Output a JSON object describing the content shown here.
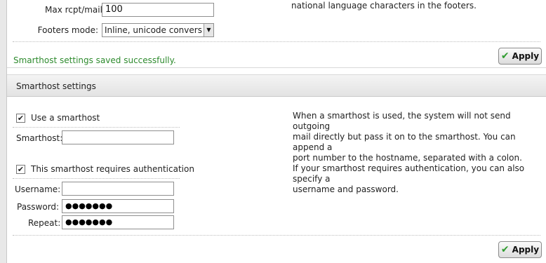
{
  "top": {
    "max_rcpt_label": "Max rcpt/mail:",
    "max_rcpt_value": "100",
    "footers_mode_label": "Footers mode:",
    "footers_mode_value": "Inline, unicode convers",
    "help_text": "national language characters in the footers.",
    "success_message": "Smarthost settings saved successfully.",
    "apply_label": "Apply"
  },
  "smarthost": {
    "section_title": "Smarthost settings",
    "use_smarthost_label": "Use a smarthost",
    "use_smarthost_checked": true,
    "smarthost_label": "Smarthost:",
    "smarthost_value": "",
    "auth_label": "This smarthost requires authentication",
    "auth_checked": true,
    "username_label": "Username:",
    "username_value": "",
    "password_label": "Password:",
    "password_value": "●●●●●●●",
    "repeat_label": "Repeat:",
    "repeat_value": "●●●●●●●",
    "help_lines": [
      "When a smarthost is used, the system will not send outgoing",
      "mail directly but pass it on to the smarthost. You can append a",
      "port number to the hostname, separated with a colon.",
      "If your smarthost requires authentication, you can also specify a",
      "username and password."
    ],
    "apply_label": "Apply"
  }
}
